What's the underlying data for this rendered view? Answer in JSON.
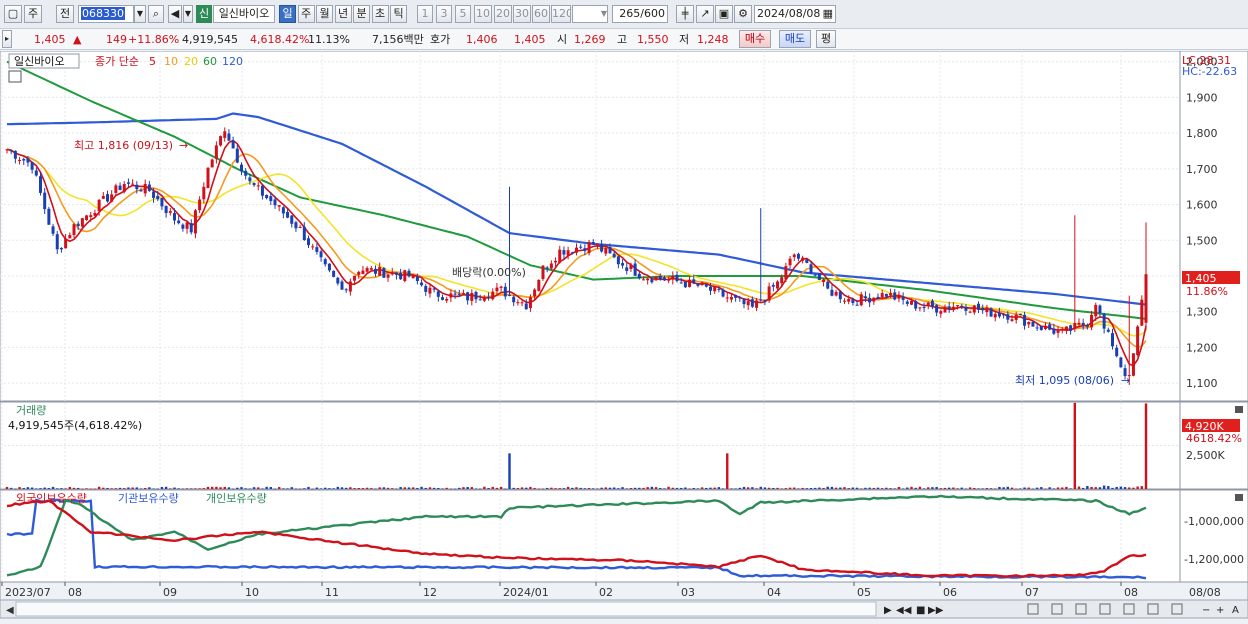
{
  "toolbar": {
    "period_type": "주",
    "period_prev": "전",
    "code": "068330",
    "market_badge": "신",
    "stock_name": "일신바이오",
    "interval_buttons": [
      "일",
      "주",
      "월",
      "년",
      "분",
      "초",
      "틱"
    ],
    "active_interval": "일",
    "count_buttons": [
      "1",
      "3",
      "5",
      "10",
      "20",
      "30",
      "60",
      "120"
    ],
    "count_value": "265",
    "count_max": "/600",
    "date": "2024/08/08"
  },
  "quote": {
    "price": "1,405",
    "change": "149",
    "change_pct": "+11.86%",
    "volume": "4,919,545",
    "volume_pct": "4,618.42%",
    "turnover": "11.13%",
    "amount": "7,156백만",
    "ask_label": "호가",
    "ask": "1,406",
    "bid": "1,405",
    "open_label": "시",
    "open": "1,269",
    "high_label": "고",
    "high": "1,550",
    "low_label": "저",
    "low": "1,248",
    "buy_label": "매수",
    "sell_label": "매도",
    "eval_label": "평"
  },
  "colors": {
    "up": "#d0101a",
    "down": "#1a3fb3",
    "ma5": "#d0101a",
    "ma10": "#f59a1e",
    "ma20": "#f2e42a",
    "ma60": "#1f9a3c",
    "ma120": "#2f5bd6",
    "foreign": "#d0101a",
    "institution": "#2f5bd6",
    "individual": "#2f8a5a"
  },
  "chart_data": [
    {
      "type": "candlestick",
      "title": "일신바이오",
      "legend": {
        "label": "종가 단순",
        "periods": [
          "5",
          "10",
          "20",
          "60",
          "120"
        ]
      },
      "ylim": [
        1050,
        2030
      ],
      "y_ticks": [
        "1,100",
        "1,200",
        "1,300",
        "1,400",
        "1,500",
        "1,600",
        "1,700",
        "1,800",
        "1,900",
        "2,000"
      ],
      "lc": "LC:28.31",
      "hc": "HC:-22.63",
      "last_price_label": "1,405",
      "last_pct_label": "11.86%",
      "annotations": {
        "high": "최고 1,816 (09/13)",
        "low": "최저 1,095 (08/06)",
        "dividend": "배당락(0.00%)"
      },
      "x_labels": [
        "2023/07",
        "08",
        "09",
        "10",
        "11",
        "12",
        "2024/01",
        "02",
        "03",
        "04",
        "05",
        "06",
        "07",
        "08",
        "08/08"
      ],
      "close_path": [
        [
          0,
          1755
        ],
        [
          6,
          1710
        ],
        [
          12,
          1470
        ],
        [
          16,
          1540
        ],
        [
          22,
          1600
        ],
        [
          28,
          1660
        ],
        [
          34,
          1640
        ],
        [
          40,
          1560
        ],
        [
          44,
          1530
        ],
        [
          48,
          1700
        ],
        [
          52,
          1816
        ],
        [
          55,
          1730
        ],
        [
          58,
          1660
        ],
        [
          64,
          1600
        ],
        [
          70,
          1530
        ],
        [
          76,
          1420
        ],
        [
          80,
          1360
        ],
        [
          84,
          1420
        ],
        [
          90,
          1410
        ],
        [
          96,
          1400
        ],
        [
          102,
          1350
        ],
        [
          110,
          1340
        ],
        [
          118,
          1360
        ],
        [
          124,
          1320
        ],
        [
          128,
          1420
        ],
        [
          132,
          1470
        ],
        [
          136,
          1480
        ],
        [
          140,
          1490
        ],
        [
          146,
          1440
        ],
        [
          152,
          1400
        ],
        [
          158,
          1390
        ],
        [
          166,
          1370
        ],
        [
          172,
          1340
        ],
        [
          178,
          1310
        ],
        [
          184,
          1380
        ],
        [
          188,
          1460
        ],
        [
          192,
          1420
        ],
        [
          196,
          1360
        ],
        [
          202,
          1330
        ],
        [
          210,
          1350
        ],
        [
          216,
          1320
        ],
        [
          222,
          1310
        ],
        [
          228,
          1320
        ],
        [
          234,
          1300
        ],
        [
          240,
          1290
        ],
        [
          246,
          1260
        ],
        [
          252,
          1240
        ],
        [
          258,
          1270
        ],
        [
          260,
          1330
        ],
        [
          262,
          1250
        ],
        [
          264,
          1210
        ],
        [
          266,
          1150
        ],
        [
          268,
          1110
        ],
        [
          270,
          1250
        ],
        [
          272,
          1405
        ]
      ],
      "ma120_path": [
        [
          0,
          1825
        ],
        [
          20,
          1830
        ],
        [
          50,
          1840
        ],
        [
          54,
          1855
        ],
        [
          60,
          1845
        ],
        [
          80,
          1770
        ],
        [
          100,
          1650
        ],
        [
          120,
          1520
        ],
        [
          140,
          1490
        ],
        [
          170,
          1460
        ],
        [
          190,
          1410
        ],
        [
          220,
          1380
        ],
        [
          250,
          1350
        ],
        [
          272,
          1320
        ]
      ],
      "ma60_path": [
        [
          0,
          2000
        ],
        [
          20,
          1890
        ],
        [
          40,
          1790
        ],
        [
          55,
          1700
        ],
        [
          70,
          1620
        ],
        [
          90,
          1570
        ],
        [
          110,
          1510
        ],
        [
          125,
          1430
        ],
        [
          140,
          1390
        ],
        [
          160,
          1400
        ],
        [
          190,
          1400
        ],
        [
          220,
          1360
        ],
        [
          250,
          1310
        ],
        [
          272,
          1280
        ]
      ]
    },
    {
      "type": "bar",
      "title": "거래량",
      "current_label": "4,919,545주(4,618.42%)",
      "y_ticks": [
        "2,500K"
      ],
      "right_value": "4,920K",
      "right_pct": "4618.42%",
      "ylim": [
        0,
        5000
      ],
      "spikes": [
        [
          120,
          2050
        ],
        [
          172,
          2050
        ],
        [
          255,
          4950
        ],
        [
          272,
          4920
        ]
      ]
    },
    {
      "type": "line",
      "legend": [
        "외국인보유수량",
        "기관보유수량",
        "개인보유수량"
      ],
      "y_ticks": [
        "-1,000,000",
        "-1,200,000"
      ],
      "note": "holdings lines (relative scale)"
    }
  ]
}
